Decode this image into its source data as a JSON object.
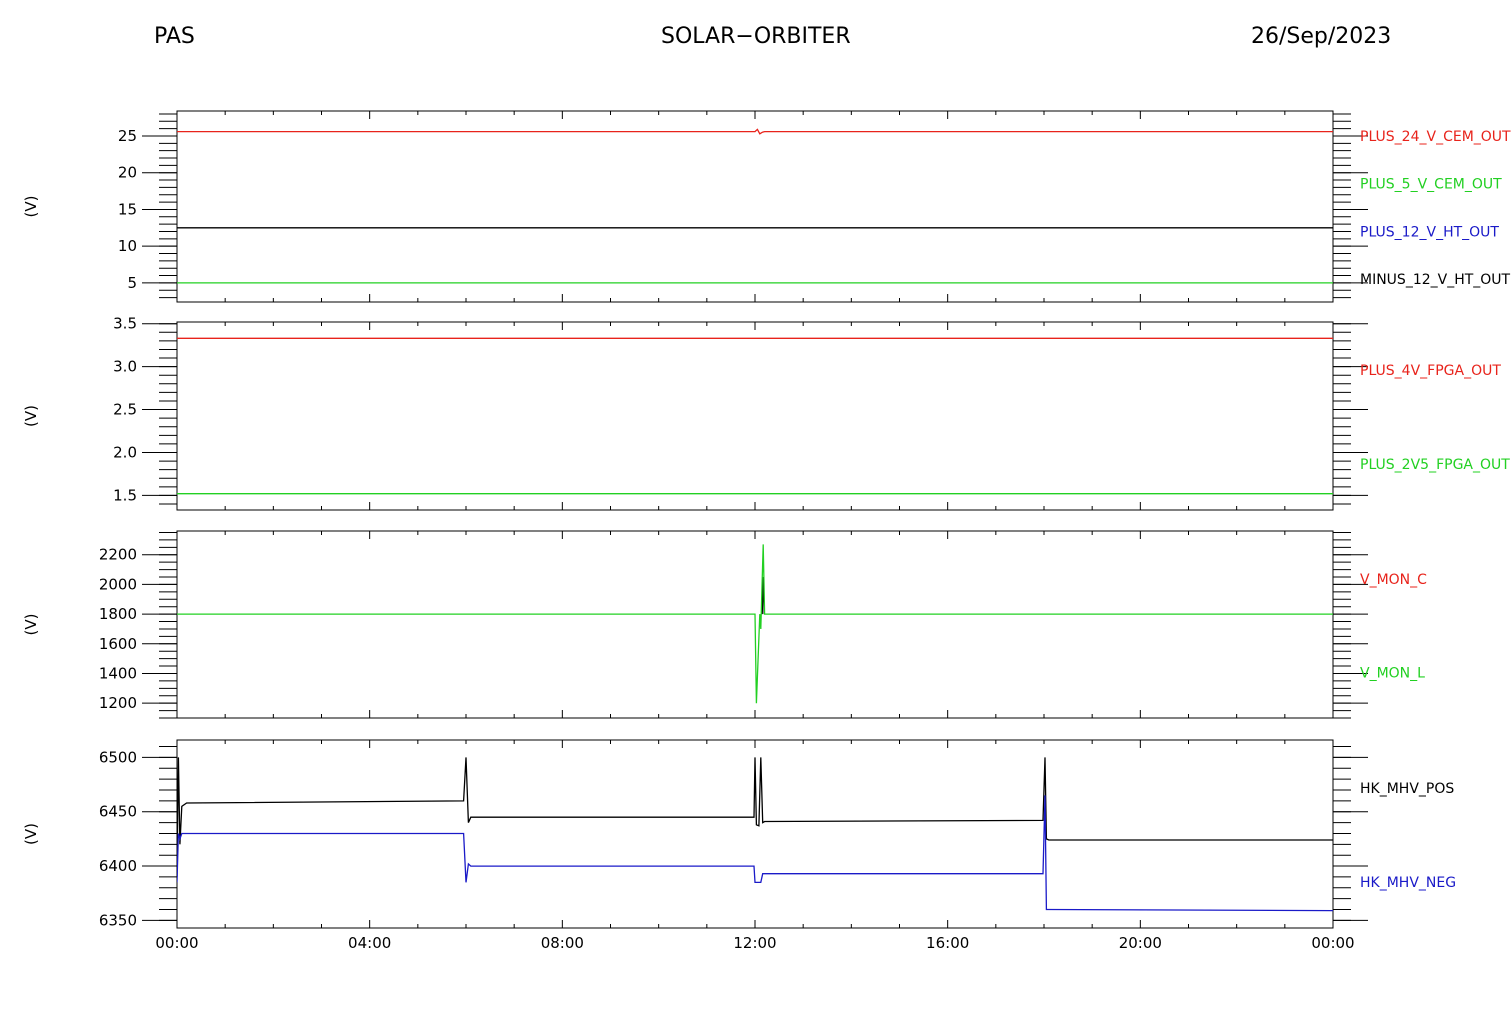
{
  "header": {
    "left": "PAS",
    "center": "SOLAR−ORBITER",
    "right": "26/Sep/2023"
  },
  "colors": {
    "red": "#e8231b",
    "green": "#22d022",
    "blue": "#1a1ac8",
    "black": "#000000"
  },
  "chart_data": [
    {
      "type": "line",
      "ylabel": "(V)",
      "ylim": [
        2.4,
        28.4
      ],
      "yticks": [
        5,
        10,
        15,
        20,
        25
      ],
      "yticklabels": [
        "5",
        "10",
        "15",
        "20",
        "25"
      ],
      "yminor": 1,
      "xlim": [
        0,
        24
      ],
      "xticks": [
        0,
        4,
        8,
        12,
        16,
        20,
        24
      ],
      "xticklabels": [
        "00:00",
        "04:00",
        "08:00",
        "12:00",
        "16:00",
        "20:00",
        "00:00"
      ],
      "show_xticklabels": false,
      "legend": [
        {
          "label": "PLUS_24_V_CEM_OUT",
          "color": "red"
        },
        {
          "label": "PLUS_5_V_CEM_OUT",
          "color": "green"
        },
        {
          "label": "PLUS_12_V_HT_OUT",
          "color": "blue"
        },
        {
          "label": "MINUS_12_V_HT_OUT",
          "color": "black"
        }
      ],
      "series": [
        {
          "color": "red",
          "x": [
            0,
            12.0,
            12.05,
            12.1,
            12.15,
            12.2,
            24
          ],
          "y": [
            25.6,
            25.6,
            25.9,
            25.3,
            25.5,
            25.6,
            25.6
          ]
        },
        {
          "color": "black",
          "x": [
            0,
            24
          ],
          "y": [
            12.5,
            12.5
          ]
        },
        {
          "color": "green",
          "x": [
            0,
            24
          ],
          "y": [
            5.0,
            5.0
          ]
        }
      ]
    },
    {
      "type": "line",
      "ylabel": "(V)",
      "ylim": [
        1.33,
        3.52
      ],
      "yticks": [
        1.5,
        2.0,
        2.5,
        3.0,
        3.5
      ],
      "yticklabels": [
        "1.5",
        "2.0",
        "2.5",
        "3.0",
        "3.5"
      ],
      "yminor": 0.1,
      "xlim": [
        0,
        24
      ],
      "xticks": [
        0,
        4,
        8,
        12,
        16,
        20,
        24
      ],
      "xticklabels": [
        "00:00",
        "04:00",
        "08:00",
        "12:00",
        "16:00",
        "20:00",
        "00:00"
      ],
      "show_xticklabels": false,
      "legend": [
        {
          "label": "PLUS_4V_FPGA_OUT",
          "color": "red"
        },
        {
          "label": "PLUS_2V5_FPGA_OUT",
          "color": "green"
        }
      ],
      "series": [
        {
          "color": "red",
          "x": [
            0,
            24
          ],
          "y": [
            3.33,
            3.33
          ]
        },
        {
          "color": "green",
          "x": [
            0,
            24
          ],
          "y": [
            1.52,
            1.52
          ]
        }
      ]
    },
    {
      "type": "line",
      "ylabel": "(V)",
      "ylim": [
        1100,
        2360
      ],
      "yticks": [
        1200,
        1400,
        1600,
        1800,
        2000,
        2200
      ],
      "yticklabels": [
        "1200",
        "1400",
        "1600",
        "1800",
        "2000",
        "2200"
      ],
      "yminor": 50,
      "xlim": [
        0,
        24
      ],
      "xticks": [
        0,
        4,
        8,
        12,
        16,
        20,
        24
      ],
      "xticklabels": [
        "00:00",
        "04:00",
        "08:00",
        "12:00",
        "16:00",
        "20:00",
        "00:00"
      ],
      "show_xticklabels": false,
      "legend": [
        {
          "label": "V_MON_C",
          "color": "red"
        },
        {
          "label": "V_MON_L",
          "color": "green"
        }
      ],
      "series": [
        {
          "color": "black",
          "x": [
            12.15,
            12.17,
            12.19
          ],
          "y": [
            1800,
            2050,
            1800
          ]
        },
        {
          "color": "green",
          "x": [
            0,
            12.0,
            12.03,
            12.1,
            12.12,
            12.17,
            12.2,
            24
          ],
          "y": [
            1800,
            1800,
            1200,
            1800,
            1700,
            2270,
            1800,
            1800
          ]
        }
      ]
    },
    {
      "type": "line",
      "ylabel": "(V)",
      "ylim": [
        6343,
        6516
      ],
      "yticks": [
        6350,
        6400,
        6450,
        6500
      ],
      "yticklabels": [
        "6350",
        "6400",
        "6450",
        "6500"
      ],
      "yminor": 10,
      "xlim": [
        0,
        24
      ],
      "xticks": [
        0,
        4,
        8,
        12,
        16,
        20,
        24
      ],
      "xticklabels": [
        "00:00",
        "04:00",
        "08:00",
        "12:00",
        "16:00",
        "20:00",
        "00:00"
      ],
      "show_xticklabels": true,
      "legend": [
        {
          "label": "HK_MHV_POS",
          "color": "black"
        },
        {
          "label": "HK_MHV_NEG",
          "color": "blue"
        }
      ],
      "series": [
        {
          "color": "black",
          "x": [
            0,
            0.03,
            0.06,
            0.1,
            0.2,
            5.95,
            6.0,
            6.05,
            6.1,
            11.98,
            12.0,
            12.03,
            12.08,
            12.12,
            12.16,
            12.2,
            17.98,
            18.02,
            18.05,
            18.1,
            24
          ],
          "y": [
            6390,
            6500,
            6420,
            6455,
            6458,
            6460,
            6500,
            6440,
            6445,
            6445,
            6500,
            6438,
            6437,
            6500,
            6440,
            6441,
            6442,
            6500,
            6425,
            6424,
            6424
          ]
        },
        {
          "color": "blue",
          "x": [
            0,
            0.03,
            0.06,
            0.1,
            0.2,
            5.95,
            6.0,
            6.05,
            6.1,
            11.98,
            12.0,
            12.03,
            12.12,
            12.16,
            12.2,
            17.98,
            18.02,
            18.05,
            18.1,
            24
          ],
          "y": [
            6385,
            6430,
            6425,
            6430,
            6430,
            6430,
            6385,
            6402,
            6400,
            6400,
            6385,
            6385,
            6385,
            6393,
            6393,
            6393,
            6465,
            6360,
            6360,
            6359
          ]
        }
      ]
    }
  ]
}
